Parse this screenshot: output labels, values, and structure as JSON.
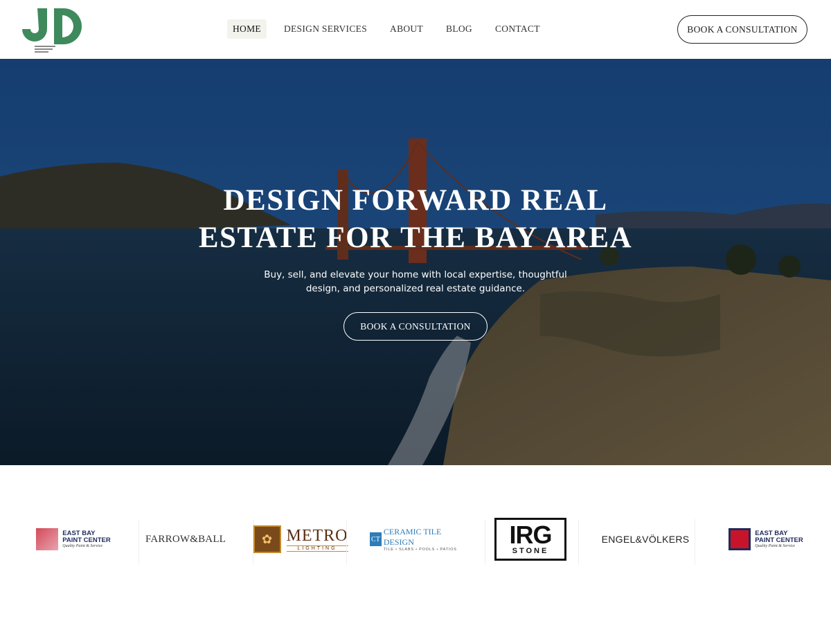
{
  "header": {
    "logo_text": "JD",
    "nav": [
      {
        "label": "HOME",
        "active": true
      },
      {
        "label": "DESIGN SERVICES",
        "active": false
      },
      {
        "label": "ABOUT",
        "active": false
      },
      {
        "label": "BLOG",
        "active": false
      },
      {
        "label": "CONTACT",
        "active": false
      }
    ],
    "cta_label": "BOOK A CONSULTATION"
  },
  "hero": {
    "title_line1": "DESIGN FORWARD REAL",
    "title_line2": "ESTATE FOR THE BAY AREA",
    "subtitle_line1": "Buy, sell, and elevate your home with local expertise, thoughtful",
    "subtitle_line2": "design, and personalized real estate guidance.",
    "cta_label": "BOOK A CONSULTATION"
  },
  "partners": {
    "east_bay_1": {
      "line1": "EAST BAY",
      "line2": "PAINT CENTER",
      "tagline": "Quality Paint & Service"
    },
    "farrow_ball": {
      "name": "FARROW&BALL"
    },
    "metro": {
      "name": "METRO",
      "sub": "LIGHTING"
    },
    "ceramic_tile": {
      "name": "CERAMIC TILE DESIGN",
      "sub": "TILE • SLABS • POOLS • PATIOS"
    },
    "irg": {
      "name": "IRG",
      "sub": "STONE"
    },
    "engel_volkers": {
      "name": "ENGEL&VÖLKERS"
    },
    "east_bay_2": {
      "line1": "EAST BAY",
      "line2": "PAINT CENTER",
      "tagline": "Quality Paint & Service"
    }
  },
  "colors": {
    "logo_green": "#3f8a5c",
    "hero_sky": "#1e5494",
    "brand_navy": "#1f2a5a"
  }
}
